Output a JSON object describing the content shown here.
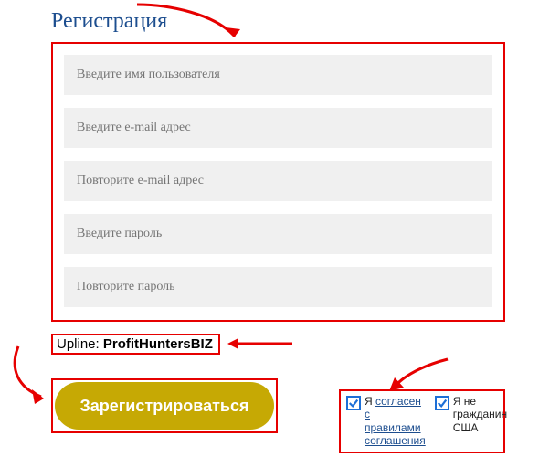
{
  "title": "Регистрация",
  "fields": {
    "username": "Введите имя пользователя",
    "email": "Введите e-mail адрес",
    "email_confirm": "Повторите e-mail адрес",
    "password": "Введите пароль",
    "password_confirm": "Повторите пароль"
  },
  "upline": {
    "label": "Upline: ",
    "value": "ProfitHuntersBIZ"
  },
  "submit": "Зарегистрироваться",
  "checkboxes": {
    "agree_prefix": "Я ",
    "agree_link": "согласен с правилами соглашения",
    "not_us": "Я не гражданин США"
  },
  "annotations": {
    "arrow_color": "#e60000",
    "highlight_color": "#e60000"
  }
}
